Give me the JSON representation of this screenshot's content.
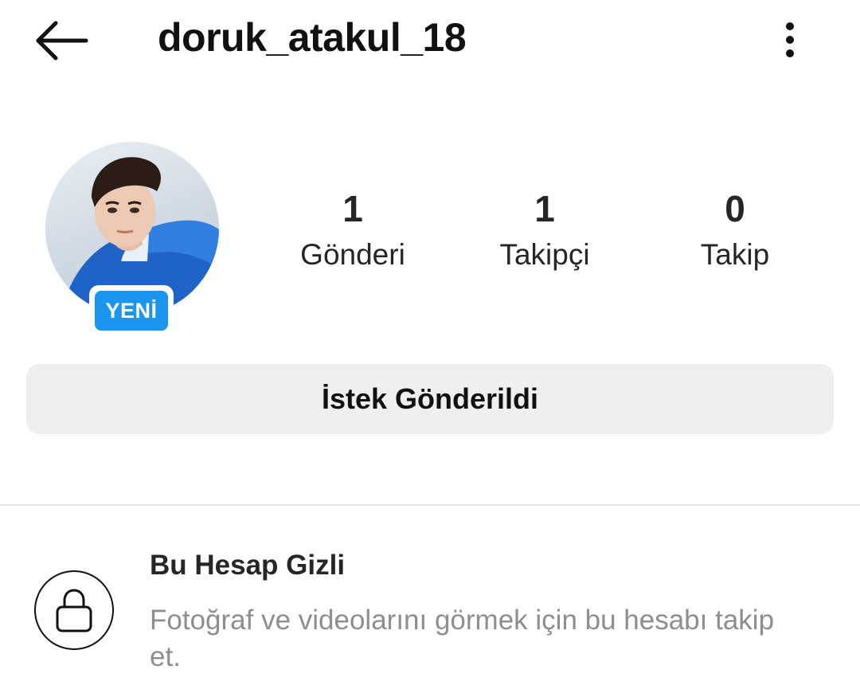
{
  "header": {
    "username": "doruk_atakul_18",
    "back_icon": "arrow-left-icon",
    "more_icon": "vertical-dots-icon"
  },
  "profile": {
    "new_badge": "YENİ",
    "stats": [
      {
        "value": "1",
        "label": "Gönderi"
      },
      {
        "value": "1",
        "label": "Takipçi"
      },
      {
        "value": "0",
        "label": "Takip"
      }
    ]
  },
  "actions": {
    "request_label": "İstek Gönderildi"
  },
  "private_notice": {
    "title": "Bu Hesap Gizli",
    "description": "Fotoğraf ve videolarını görmek için bu hesabı takip et.",
    "icon": "lock-icon"
  },
  "colors": {
    "badge_blue": "#1a95f0",
    "button_gray": "#efefef",
    "secondary_text": "#8e8e8e"
  }
}
